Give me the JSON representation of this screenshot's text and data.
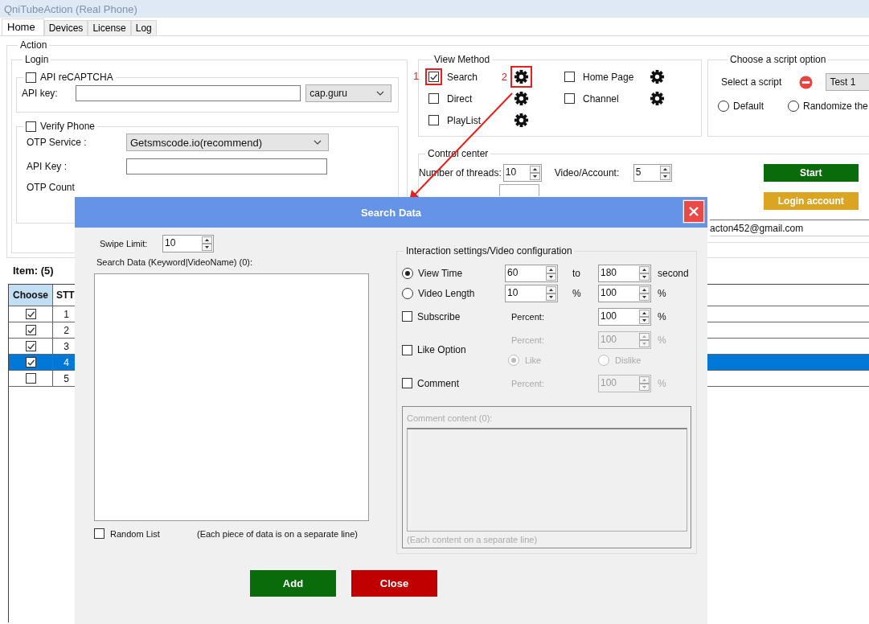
{
  "window": {
    "title": "QniTubeAction (Real Phone)"
  },
  "tabs": [
    {
      "label": "Home",
      "selected": true
    },
    {
      "label": "Devices",
      "selected": false
    },
    {
      "label": "License",
      "selected": false
    },
    {
      "label": "Log",
      "selected": false
    }
  ],
  "action": {
    "title": "Action",
    "login": {
      "title": "Login",
      "recaptcha": {
        "label": "API reCAPTCHA",
        "checked": false,
        "api_key_label": "API key:",
        "provider": "cap.guru"
      },
      "verify_phone": {
        "label": "Verify Phone",
        "checked": false,
        "otp_service_label": "OTP Service :",
        "otp_service": "Getsmscode.io(recommend)",
        "api_key_label": "API Key :",
        "otp_count_label": "OTP Count"
      }
    },
    "view_method": {
      "title": "View Method",
      "options": [
        {
          "label": "Search",
          "checked": true,
          "callout": "1",
          "settings_callout": "2"
        },
        {
          "label": "Direct",
          "checked": false
        },
        {
          "label": "PlayList",
          "checked": false
        },
        {
          "label": "Home Page",
          "checked": false
        },
        {
          "label": "Channel",
          "checked": false
        }
      ]
    },
    "script_option": {
      "title": "Choose a script option",
      "select_label": "Select a script",
      "script": "Test 1",
      "radios": [
        {
          "label": "Default",
          "selected": false
        },
        {
          "label": "Randomize the",
          "selected": false
        }
      ]
    },
    "control_center": {
      "title": "Control center",
      "threads_label": "Number of threads:",
      "threads": "10",
      "video_label": "Video/Account:",
      "video": "5",
      "buttons": [
        {
          "label": "Start",
          "kind": "start"
        },
        {
          "label": "Login account",
          "kind": "login"
        }
      ],
      "account_email": "acton452@gmail.com"
    }
  },
  "items": {
    "title": "Item: (5)",
    "columns": [
      "Choose",
      "STT"
    ],
    "rows": [
      {
        "stt": "1",
        "checked": true,
        "selected": false
      },
      {
        "stt": "2",
        "checked": true,
        "selected": false
      },
      {
        "stt": "3",
        "checked": true,
        "selected": false
      },
      {
        "stt": "4",
        "checked": true,
        "selected": true
      },
      {
        "stt": "5",
        "checked": false,
        "selected": false
      }
    ]
  },
  "dialog": {
    "title": "Search Data",
    "swipe_label": "Swipe Limit:",
    "swipe": "10",
    "data_label": "Search Data (Keyword|VideoName) (0):",
    "random": {
      "label": "Random List",
      "checked": false
    },
    "hint": "(Each piece of data is on a separate line)",
    "interaction": {
      "title": "Interaction settings/Video configuration",
      "modes": [
        {
          "label": "View Time",
          "selected": true,
          "from": "60",
          "separator": "to",
          "to": "180",
          "unit": "second"
        },
        {
          "label": "Video Length",
          "selected": false,
          "from": "10",
          "separator": "%",
          "to": "100",
          "unit": "%"
        }
      ],
      "actions": [
        {
          "label": "Subscribe",
          "checked": false,
          "percent_label": "Percent:",
          "percent": "100",
          "unit": "%",
          "disabled": false
        },
        {
          "label": "Like Option",
          "checked": false,
          "percent_label": "Percent:",
          "percent": "100",
          "unit": "%",
          "disabled": true,
          "choices": [
            {
              "label": "Like",
              "selected": true
            },
            {
              "label": "Dislike",
              "selected": false
            }
          ]
        },
        {
          "label": "Comment",
          "checked": false,
          "percent_label": "Percent:",
          "percent": "100",
          "unit": "%",
          "disabled": true
        }
      ],
      "comment": {
        "label": "Comment content (0):",
        "hint": "(Each content on a separate line)"
      }
    },
    "buttons": [
      {
        "label": "Add",
        "kind": "add"
      },
      {
        "label": "Close",
        "kind": "close"
      }
    ]
  }
}
